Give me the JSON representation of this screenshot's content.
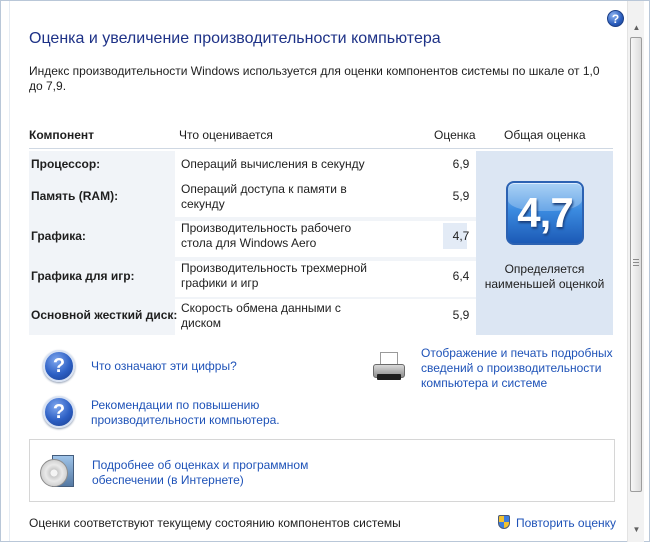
{
  "window": {
    "title": "Оценка и увеличение производительности компьютера",
    "help_label": "?"
  },
  "intro": "Индекс производительности Windows используется для оценки компонентов системы по шкале от 1,0 до 7,9.",
  "table": {
    "headers": {
      "component": "Компонент",
      "what": "Что оценивается",
      "score": "Оценка",
      "overall": "Общая оценка"
    },
    "rows": [
      {
        "component": "Процессор:",
        "what": "Операций вычисления в секунду",
        "score": "6,9"
      },
      {
        "component": "Память (RAM):",
        "what": "Операций доступа к памяти в секунду",
        "score": "5,9"
      },
      {
        "component": "Графика:",
        "what": "Производительность рабочего стола для Windows Aero",
        "score": "4,7",
        "lowest": true
      },
      {
        "component": "Графика для игр:",
        "what": "Производительность трехмерной графики и игр",
        "score": "6,4"
      },
      {
        "component": "Основной жесткий диск:",
        "what": "Скорость обмена данными с диском",
        "score": "5,9"
      }
    ],
    "overall": {
      "value": "4,7",
      "caption": "Определяется наименьшей оценкой"
    }
  },
  "links": {
    "what_numbers_mean": "Что означают эти цифры?",
    "tips": "Рекомендации по повышению производительности компьютера.",
    "print_details": "Отображение и печать подробных сведений о производительности компьютера и системе",
    "online_info": "Подробнее об оценках и программном обеспечении (в Интернете)"
  },
  "footer": {
    "status": "Оценки соответствуют текущему состоянию компонентов системы",
    "rescore": "Повторить оценку"
  },
  "colors": {
    "title": "#1e3287",
    "link": "#1f53b8",
    "badge": "#3b8be0",
    "panel": "#dce6f3"
  },
  "icons": [
    "help-icon",
    "question-icon",
    "printer-icon",
    "software-icon",
    "shield-icon",
    "scroll-up-arrow-icon",
    "scroll-down-arrow-icon"
  ]
}
